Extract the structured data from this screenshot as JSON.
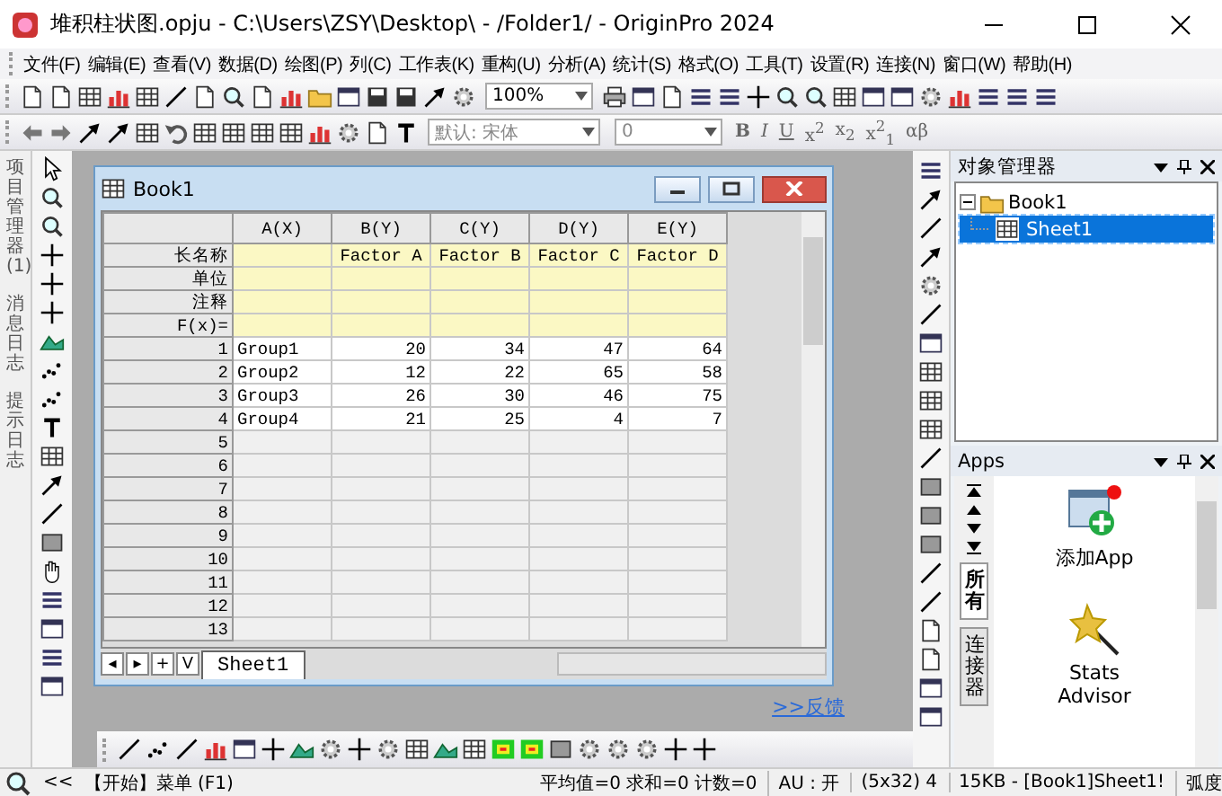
{
  "window": {
    "title": "堆积柱状图.opju - C:\\Users\\ZSY\\Desktop\\ - /Folder1/ - OriginPro 2024"
  },
  "menu": [
    "文件(F)",
    "编辑(E)",
    "查看(V)",
    "数据(D)",
    "绘图(P)",
    "列(C)",
    "工作表(K)",
    "重构(U)",
    "分析(A)",
    "统计(S)",
    "格式(O)",
    "工具(T)",
    "设置(R)",
    "连接(N)",
    "窗口(W)",
    "帮助(H)"
  ],
  "toolbar": {
    "zoom": "100%",
    "font": "默认: 宋体",
    "font_size": "0",
    "format_buttons": [
      "B",
      "I",
      "U",
      "x$^{2}$",
      "x$_{2}$",
      "x$^{2}$$_{1}$",
      "αβ"
    ]
  },
  "side_tabs": [
    {
      "label": "项目管理器 (1)"
    },
    {
      "label": "消息日志"
    },
    {
      "label": "提示日志"
    }
  ],
  "workbook": {
    "title": "Book1",
    "columns": [
      {
        "name": "A(X)"
      },
      {
        "name": "B(Y)",
        "long_name": "Factor A"
      },
      {
        "name": "C(Y)",
        "long_name": "Factor B"
      },
      {
        "name": "D(Y)",
        "long_name": "Factor C"
      },
      {
        "name": "E(Y)",
        "long_name": "Factor D"
      }
    ],
    "meta_rows": [
      {
        "label": "长名称",
        "kind": "long_name"
      },
      {
        "label": "单位",
        "kind": "units"
      },
      {
        "label": "注释",
        "kind": "comments"
      },
      {
        "label": "F(x)=",
        "kind": "formula"
      }
    ],
    "rows": [
      {
        "label": "1",
        "cells": [
          "Group1",
          "20",
          "34",
          "47",
          "64"
        ]
      },
      {
        "label": "2",
        "cells": [
          "Group2",
          "12",
          "22",
          "65",
          "58"
        ]
      },
      {
        "label": "3",
        "cells": [
          "Group3",
          "26",
          "30",
          "46",
          "75"
        ]
      },
      {
        "label": "4",
        "cells": [
          "Group4",
          "21",
          "25",
          "4",
          "7"
        ]
      },
      {
        "label": "5",
        "cells": []
      },
      {
        "label": "6",
        "cells": []
      },
      {
        "label": "7",
        "cells": []
      },
      {
        "label": "8",
        "cells": []
      },
      {
        "label": "9",
        "cells": []
      },
      {
        "label": "10",
        "cells": []
      },
      {
        "label": "11",
        "cells": []
      },
      {
        "label": "12",
        "cells": []
      },
      {
        "label": "13",
        "cells": []
      }
    ],
    "sheet_nav": [
      "◂",
      "▸",
      "+",
      "V"
    ],
    "sheet_tabs": [
      {
        "label": "Sheet1",
        "selected": true
      }
    ]
  },
  "feedback_link": ">>反馈",
  "object_manager": {
    "title": "对象管理器",
    "tree": [
      {
        "label": "Book1",
        "expanded": true,
        "children": [
          {
            "label": "Sheet1",
            "selected": true
          }
        ]
      }
    ]
  },
  "apps": {
    "title": "Apps",
    "tabs": [
      {
        "label": "所有",
        "selected": true
      },
      {
        "label": "连接器",
        "selected": false
      }
    ],
    "items": [
      {
        "label": "添加App",
        "kind": "add"
      },
      {
        "label": "Stats Advisor",
        "kind": "wand"
      }
    ]
  },
  "status_bar": {
    "back": "<<",
    "start": "【开始】菜单 (F1)",
    "stats": "平均值=0 求和=0 计数=0",
    "au": "AU : 开",
    "dims": "(5x32) 4",
    "info": "15KB - [Book1]Sheet1!",
    "angle": "弧度"
  }
}
